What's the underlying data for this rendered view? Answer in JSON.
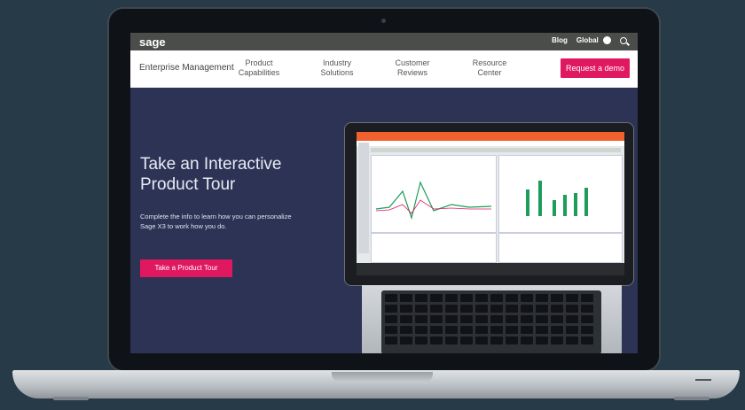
{
  "topbar": {
    "logo": "sage",
    "blog": "Blog",
    "global": "Global"
  },
  "nav": {
    "brand": "Enterprise Management",
    "items": [
      {
        "line1": "Product",
        "line2": "Capabilities"
      },
      {
        "line1": "Industry",
        "line2": "Solutions"
      },
      {
        "line1": "Customer",
        "line2": "Reviews"
      },
      {
        "line1": "Resource",
        "line2": "Center"
      }
    ],
    "demo_button": "Request a demo"
  },
  "hero": {
    "title_line1": "Take an Interactive",
    "title_line2": "Product Tour",
    "subtitle_line1": "Complete the info to learn how you can personalize",
    "subtitle_line2": "Sage X3 to work how you do.",
    "cta": "Take a Product Tour"
  },
  "colors": {
    "accent": "#e0185f",
    "hero_bg": "#2c3355",
    "topbar_bg": "#4a4d4a",
    "inner_header": "#f0612e"
  },
  "icons": [
    "globe-icon",
    "search-icon"
  ]
}
